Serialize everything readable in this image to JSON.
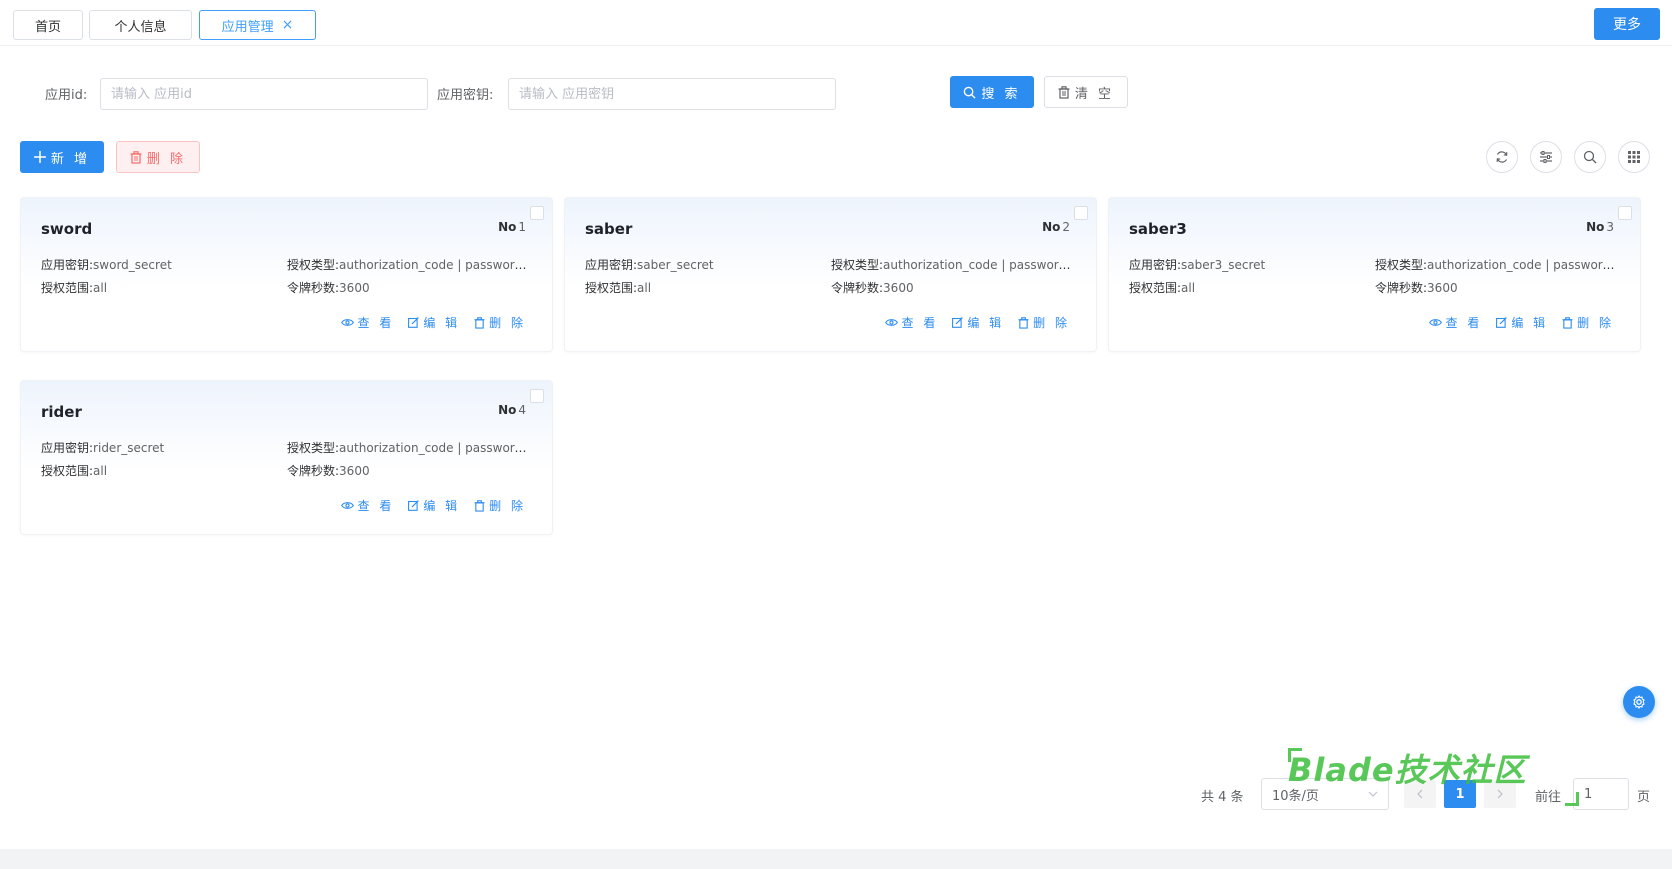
{
  "tabs": [
    {
      "label": "首页"
    },
    {
      "label": "个人信息"
    },
    {
      "label": "应用管理",
      "close": "×"
    }
  ],
  "more_label": "更多",
  "search": {
    "app_id_label": "应用id:",
    "app_id_placeholder": "请输入 应用id",
    "app_secret_label": "应用密钥:",
    "app_secret_placeholder": "请输入 应用密钥",
    "search_label": "搜 索",
    "clear_label": "清 空"
  },
  "toolbar": {
    "add_label": "新 增",
    "delete_label": "删 除",
    "icons": [
      "refresh-icon",
      "filter-icon",
      "search-icon",
      "grid-icon"
    ]
  },
  "card_labels": {
    "secret": "应用密钥:",
    "grant": "授权类型:",
    "scope": "授权范围:",
    "token": "令牌秒数:",
    "no": "No",
    "view": "查 看",
    "edit": "编 辑",
    "delete": "删 除"
  },
  "cards": [
    {
      "name": "sword",
      "no": "1",
      "secret": "sword_secret",
      "grant": "authorization_code | password | ...",
      "scope": "all",
      "token": "3600"
    },
    {
      "name": "saber",
      "no": "2",
      "secret": "saber_secret",
      "grant": "authorization_code | password | ...",
      "scope": "all",
      "token": "3600"
    },
    {
      "name": "saber3",
      "no": "3",
      "secret": "saber3_secret",
      "grant": "authorization_code | password | ...",
      "scope": "all",
      "token": "3600"
    },
    {
      "name": "rider",
      "no": "4",
      "secret": "rider_secret",
      "grant": "authorization_code | password | ...",
      "scope": "all",
      "token": "3600"
    }
  ],
  "pagination": {
    "total": "共 4 条",
    "page_size": "10条/页",
    "current": "1",
    "goto_label": "前往",
    "goto_value": "1",
    "page_label": "页"
  },
  "watermark": "Blade技术社区",
  "colors": {
    "primary": "#2d8cf0",
    "danger": "#f56c6c",
    "watermark": "#3cbe3c"
  }
}
